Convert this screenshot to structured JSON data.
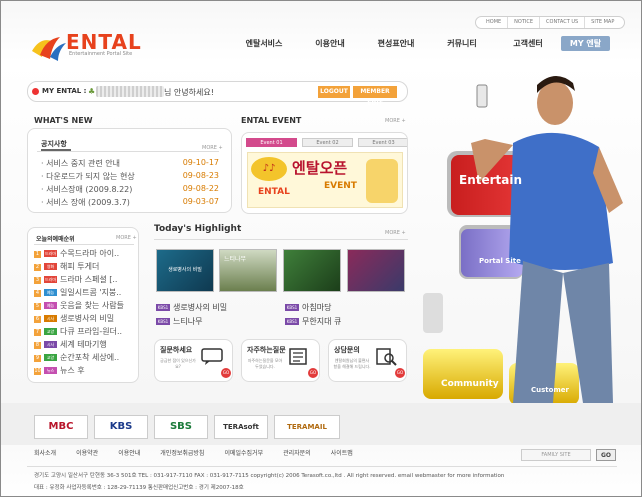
{
  "header": {
    "top_links": [
      "HOME",
      "NOTICE",
      "CONTACT US",
      "SITE MAP"
    ],
    "logo_text": "ENTAL",
    "logo_sub": "Entertainment Portal Site",
    "nav": [
      "엔탈서비스",
      "이용안내",
      "편성표안내",
      "커뮤니티",
      "고객센터"
    ],
    "my_ental_tab": "MY 엔탈"
  },
  "my_ental": {
    "label": "MY ENTAL :",
    "greeting": "님 안녕하세요!",
    "logout": "LOGOUT",
    "member_edit": "MEMBER EDIT"
  },
  "whats_new": {
    "title": "WHAT'S NEW",
    "tab": "공지사항",
    "more": "MORE +",
    "items": [
      {
        "title": "서비스 중지 관련 안내",
        "date": "09-10-17"
      },
      {
        "title": "다운로드가 되지 않는 현상",
        "date": "09-08-23"
      },
      {
        "title": "서비스장애 (2009.8.22)",
        "date": "09-08-22"
      },
      {
        "title": "서비스 장애 (2009.3.7)",
        "date": "09-03-07"
      }
    ]
  },
  "ental_event": {
    "title": "ENTAL EVENT",
    "more": "MORE +",
    "tabs": [
      "Event 01",
      "Event 02",
      "Event 03"
    ],
    "banner_main": "엔탈오픈",
    "banner_sub": "EVENT",
    "banner_logo": "ENTAL"
  },
  "favorites": {
    "title": "오늘의예매순위",
    "more": "MORE +",
    "items": [
      {
        "rank": "1",
        "badge": "드라마",
        "color": "#e2463a",
        "title": "수목드라마 아이.."
      },
      {
        "rank": "2",
        "badge": "영화",
        "color": "#e2463a",
        "title": "해피 투게더"
      },
      {
        "rank": "3",
        "badge": "드라마",
        "color": "#e2463a",
        "title": "드라마 스페셜 [.."
      },
      {
        "rank": "4",
        "badge": "예능",
        "color": "#2f8fd0",
        "title": "일일시트콤 '지붕.."
      },
      {
        "rank": "5",
        "badge": "예능",
        "color": "#c44fb0",
        "title": "웃음을 찾는 사람들"
      },
      {
        "rank": "6",
        "badge": "시사",
        "color": "#d87b00",
        "title": "생로병사의 비밀"
      },
      {
        "rank": "7",
        "badge": "교양",
        "color": "#3aa542",
        "title": "다큐 프라임-원더.."
      },
      {
        "rank": "8",
        "badge": "시사",
        "color": "#7b4aa8",
        "title": "세계 테마기행"
      },
      {
        "rank": "9",
        "badge": "교양",
        "color": "#3aa542",
        "title": "순간포착 세상에.."
      },
      {
        "rank": "10",
        "badge": "뉴스",
        "color": "#c44fb0",
        "title": "뉴스 후"
      }
    ]
  },
  "highlight": {
    "title": "Today's Highlight",
    "more": "MORE +",
    "thumb1_caption": "생로병사의 비밀",
    "thumb2_caption": "느티나무",
    "items": [
      {
        "badge": "KBS1",
        "title": "생로병사의 비밀"
      },
      {
        "badge": "KBS1",
        "title": "느티나무"
      },
      {
        "badge": "KBS1",
        "title": "아침마당"
      },
      {
        "badge": "KBS1",
        "title": "무한지대 큐"
      }
    ]
  },
  "qboxes": [
    {
      "title": "질문하세요",
      "desc": "궁금한 점이 있으신가요?",
      "go": "GO"
    },
    {
      "title": "자주하는질문",
      "desc": "자주하는질문을 모아두었습니다.",
      "go": "GO"
    },
    {
      "title": "상담문의",
      "desc": "엔탈회원님의 불편사항을 해결해 드립니다.",
      "go": "GO"
    }
  ],
  "hero": {
    "card1": "Entertain",
    "card2": "Portal Site",
    "card3": "Community",
    "card4": "Customer"
  },
  "footer": {
    "banners": [
      {
        "label": "MBC",
        "color": "#b8142a"
      },
      {
        "label": "KBS",
        "color": "#1b3a8a"
      },
      {
        "label": "SBS",
        "color": "#1b7a3a"
      },
      {
        "label": "TERAsoft",
        "color": "#333333"
      },
      {
        "label": "TERAMAIL",
        "color": "#b06a10"
      }
    ],
    "links": [
      "회사소개",
      "이용약관",
      "이용안내",
      "개인정보취급방침",
      "이메일수집거부",
      "관리자문의",
      "사이트맵"
    ],
    "family_site": "FAMILY SITE",
    "go": "GO",
    "address": "경기도 고양시 일산서구 탄현동 36-3 501호  TEL : 031-917-7110  FAX : 031-917-7115 copyright(c) 2006 Terasoft.co.,ltd . All right reserved. email webmaster for more information",
    "business": "대표 : 유정화    사업자등록번호 : 128-29-71139    통신판매업신고번호 : 경기 제2007-18호"
  }
}
